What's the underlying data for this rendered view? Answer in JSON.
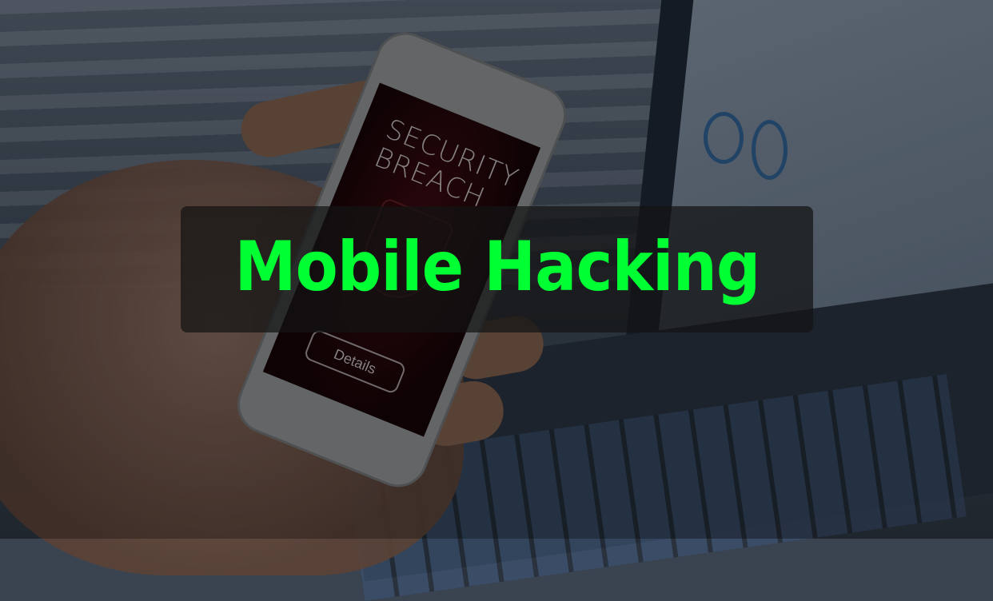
{
  "title": "Mobile Hacking",
  "title_color": "#00ff33",
  "phone_screen": {
    "headline": "SECURITY\nBREACH",
    "button_label": "Details",
    "icon": "shield-lock-icon"
  }
}
